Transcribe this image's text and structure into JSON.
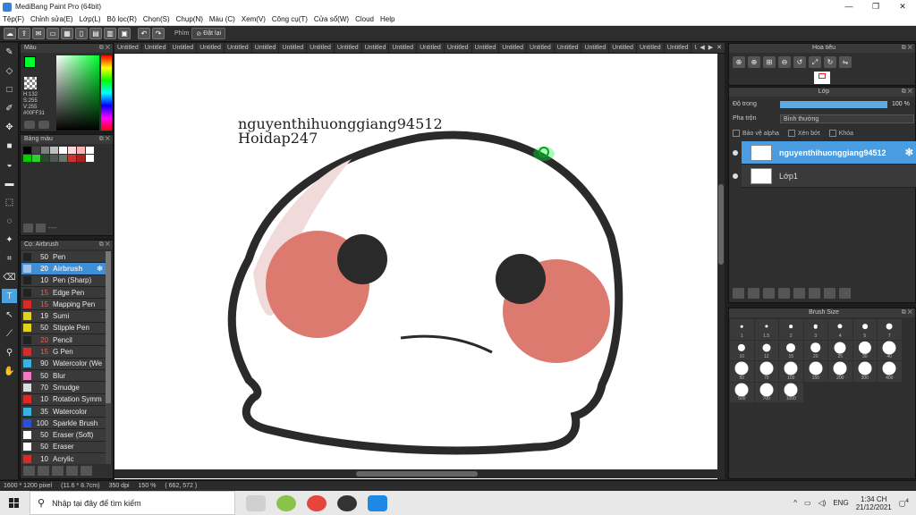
{
  "window": {
    "title": "MediBang Paint Pro (64bit)",
    "controls": [
      "—",
      "❐",
      "✕"
    ]
  },
  "menu": [
    "Tệp(F)",
    "Chỉnh sửa(E)",
    "Lớp(L)",
    "Bộ lọc(R)",
    "Chọn(S)",
    "Chụp(N)",
    "Màu (C)",
    "Xem(V)",
    "Công cụ(T)",
    "Cửa sổ(W)",
    "Cloud",
    "Help"
  ],
  "toolbar": {
    "key_label": "Phím",
    "reset_label": "Đặt lại"
  },
  "color_panel": {
    "title": "Màu",
    "hsv": [
      "H:132",
      "S:255",
      "V:255",
      "#00FF31"
    ],
    "fg_color": "#00ff31"
  },
  "palette_panel": {
    "title": "Bảng màu",
    "colors": [
      "#000000",
      "#404040",
      "#7f7f7f",
      "#bfbfbf",
      "#ffffff",
      "#ffd8d8",
      "#ffb0b0",
      "#ffffff",
      "#00cc00",
      "#33cc33",
      "#2a4a2a",
      "#555555",
      "#667766",
      "#cc3333",
      "#aa2222",
      "#ffffff"
    ],
    "empty_label": "----"
  },
  "brush_panel": {
    "title": "Cọ: Airbrush",
    "items": [
      {
        "size": "50",
        "name": "Pen",
        "color": "#222222"
      },
      {
        "size": "20",
        "name": "Airbrush",
        "color": "#9fc3ea",
        "selected": true
      },
      {
        "size": "10",
        "name": "Pen (Sharp)",
        "color": "#222222"
      },
      {
        "size": "15",
        "name": "Edge Pen",
        "color": "#222222"
      },
      {
        "size": "15",
        "name": "Mapping Pen",
        "color": "#d92a2a"
      },
      {
        "size": "19",
        "name": "Sumi",
        "color": "#e3d21d"
      },
      {
        "size": "50",
        "name": "Stipple Pen",
        "color": "#e3d21d"
      },
      {
        "size": "20",
        "name": "Pencil",
        "color": "#222222"
      },
      {
        "size": "15",
        "name": "G Pen",
        "color": "#d92a2a"
      },
      {
        "size": "90",
        "name": "Watercolor (We",
        "color": "#3bb3e0"
      },
      {
        "size": "50",
        "name": "Blur",
        "color": "#f07bc4"
      },
      {
        "size": "70",
        "name": "Smudge",
        "color": "#dddddd"
      },
      {
        "size": "10",
        "name": "Rotation Symm",
        "color": "#d92a2a"
      },
      {
        "size": "35",
        "name": "Watercolor",
        "color": "#3bb3e0"
      },
      {
        "size": "100",
        "name": "Sparkle Brush",
        "color": "#2a4fd9"
      },
      {
        "size": "50",
        "name": "Eraser (Soft)",
        "color": "#ffffff"
      },
      {
        "size": "50",
        "name": "Eraser",
        "color": "#ffffff"
      },
      {
        "size": "10",
        "name": "Acrylic",
        "color": "#d92a2a"
      }
    ]
  },
  "doc_tabs": [
    "Untitled",
    "Untitled",
    "Untitled",
    "Untitled",
    "Untitled",
    "Untitled",
    "Untitled",
    "Untitled",
    "Untitled",
    "Untitled",
    "Untitled",
    "Untitled",
    "Untitled",
    "Untitled",
    "Untitled",
    "Untitled",
    "Untitled",
    "Untitled",
    "Untitled",
    "Untitled",
    "Untitled",
    "Untitled",
    "Untitled",
    "Untitled",
    "Untitled",
    "Untitled",
    "Untitled"
  ],
  "canvas": {
    "text_line1": "nguyenthihuonggiang94512",
    "text_line2": "Hoidap247"
  },
  "status": {
    "size": "1600 * 1200 pixel",
    "physical": "(11.6 * 8.7cm)",
    "dpi": "350 dpi",
    "zoom": "150 %",
    "coords": "( 662, 572 )"
  },
  "navigator": {
    "title": "Hoa tiêu"
  },
  "layer_panel": {
    "title": "Lớp",
    "opacity_label": "Độ trong",
    "opacity_value": "100 %",
    "blend_label": "Pha trộn",
    "blend_value": "Bình thường",
    "checks": [
      "Bảo vệ alpha",
      "Xén bớt",
      "Khóa"
    ],
    "layers": [
      {
        "name": "nguyenthihuonggiang94512",
        "selected": true
      },
      {
        "name": "Lớp1",
        "selected": false
      }
    ]
  },
  "brush_size_panel": {
    "title": "Brush Size",
    "sizes": [
      "1",
      "1.5",
      "2",
      "3",
      "4",
      "5",
      "7",
      "10",
      "12",
      "15",
      "20",
      "25",
      "30",
      "40",
      "50",
      "70",
      "100",
      "150",
      "200",
      "300",
      "400",
      "500",
      "700",
      "1000"
    ]
  },
  "taskbar": {
    "search_placeholder": "Nhập tại đây để tìm kiếm",
    "lang": "ENG",
    "time": "1:34 CH",
    "date": "21/12/2021",
    "notification_count": "4"
  }
}
